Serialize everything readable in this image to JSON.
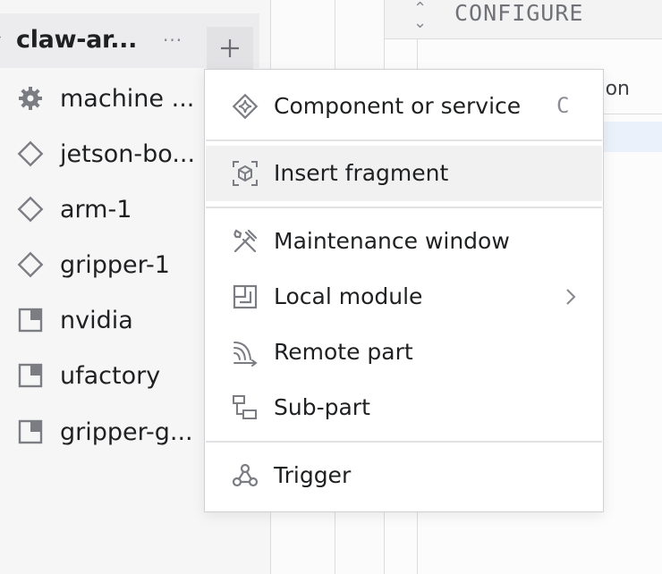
{
  "tree": {
    "header": {
      "title": "claw-ar...",
      "more_label": "···",
      "add_label": "+"
    },
    "items": [
      {
        "label": "machine ...",
        "icon": "gear-icon"
      },
      {
        "label": "jetson-bo...",
        "icon": "component-diamond-icon"
      },
      {
        "label": "arm-1",
        "icon": "component-diamond-icon"
      },
      {
        "label": "gripper-1",
        "icon": "component-diamond-icon"
      },
      {
        "label": "nvidia",
        "icon": "module-icon"
      },
      {
        "label": "ufactory",
        "icon": "module-icon"
      },
      {
        "label": "gripper-g...",
        "icon": "module-icon"
      }
    ]
  },
  "config": {
    "title": "CONFIGURE",
    "partial_text": "on"
  },
  "menu": {
    "items": [
      {
        "label": "Component or service",
        "icon": "component-sparkle-icon",
        "shortcut": "C"
      },
      {
        "label": "Insert fragment",
        "icon": "fragment-cube-icon",
        "highlighted": true
      },
      {
        "label": "Maintenance window",
        "icon": "tools-icon"
      },
      {
        "label": "Local module",
        "icon": "module-icon",
        "submenu": true
      },
      {
        "label": "Remote part",
        "icon": "remote-signal-icon"
      },
      {
        "label": "Sub-part",
        "icon": "sub-part-icon"
      },
      {
        "label": "Trigger",
        "icon": "webhook-icon"
      }
    ]
  },
  "colors": {
    "panel_bg": "#f6f6f7",
    "header_bg": "#ececee",
    "menu_highlight": "#f1f1f2",
    "selection_blue": "#eaf1fb",
    "icon_gray": "#7b7d83"
  }
}
